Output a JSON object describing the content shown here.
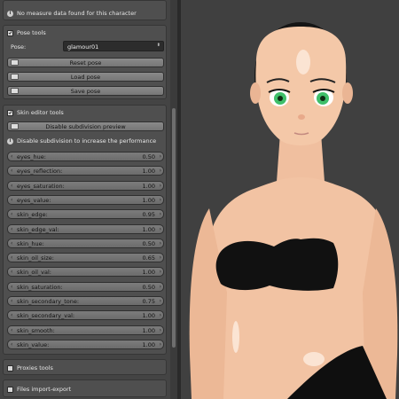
{
  "top_notice": "No measure data found for this character",
  "pose_tools": {
    "title": "Pose tools",
    "pose_label": "Pose:",
    "pose_value": "glamour01",
    "buttons": [
      "Reset pose",
      "Load pose",
      "Save pose"
    ]
  },
  "skin_editor": {
    "title": "Skin editor tools",
    "disable_button": "Disable subdivision preview",
    "info": "Disable subdivision to increase the performance",
    "sliders": [
      {
        "label": "eyes_hue:",
        "value": "0.50"
      },
      {
        "label": "eyes_reflection:",
        "value": "1.00"
      },
      {
        "label": "eyes_saturation:",
        "value": "1.00"
      },
      {
        "label": "eyes_value:",
        "value": "1.00"
      },
      {
        "label": "skin_edge:",
        "value": "0.95"
      },
      {
        "label": "skin_edge_val:",
        "value": "1.00"
      },
      {
        "label": "skin_hue:",
        "value": "0.50"
      },
      {
        "label": "skin_oil_size:",
        "value": "0.65"
      },
      {
        "label": "skin_oil_val:",
        "value": "1.00"
      },
      {
        "label": "skin_saturation:",
        "value": "0.50"
      },
      {
        "label": "skin_secondary_tone:",
        "value": "0.75"
      },
      {
        "label": "skin_secondary_val:",
        "value": "1.00"
      },
      {
        "label": "skin_smooth:",
        "value": "1.00"
      },
      {
        "label": "skin_value:",
        "value": "1.00"
      }
    ]
  },
  "proxies_tools": {
    "title": "Proxies tools"
  },
  "files_import_export": {
    "title": "Files import-export"
  },
  "colors": {
    "panel_bg": "#444444",
    "viewport_bg": "#404040",
    "skin": "#f2c3a3",
    "bra": "#111111",
    "eyes": "#3fbf6a"
  }
}
